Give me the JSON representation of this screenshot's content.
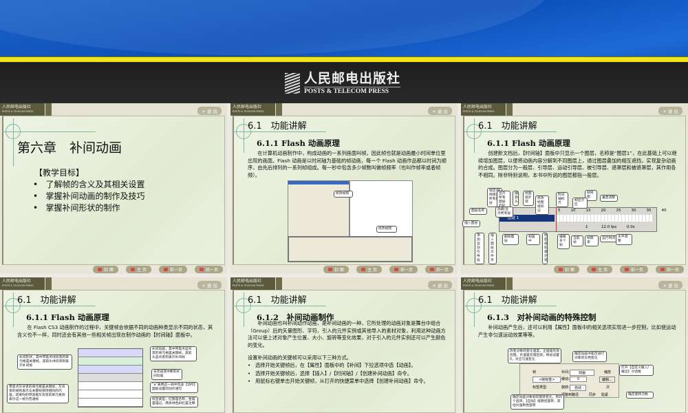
{
  "banner": {
    "logo_cn": "人民邮电出版社",
    "logo_en": "POSTS & TELECOM PRESS"
  },
  "chrome": {
    "plogo_cn": "人民邮电出版社",
    "plogo_en": "POSTS & TELECOM PRESS",
    "exit": "× 退 出",
    "nav": [
      "封 面",
      "主 页",
      "前一页",
      "后一页"
    ]
  },
  "slides": [
    {
      "title": "第六章　补间动画",
      "objectives_heading": "【教学目标】",
      "items": [
        "了解帧的含义及其相关设置",
        "掌握补间动画的制作及技巧",
        "掌握补间形状的制作"
      ]
    },
    {
      "section": "6.1　功能讲解",
      "sub": "6.1.1 Flash 动画原理",
      "para": "在计算机动画制作中，构成动画的一系列画面叫帧，因此帧也就是动画最小时间单位里出现的画面。Flash 动画是以时间轴为基础的帧动画，每一个 Flash 动画作品都以时间为顺序，由先后排列的一系列帧组成。每一秒中包含多少帧数叫做帧频率（也叫作帧率或者帧频）。",
      "callouts": [
        "修改帧频",
        "修改帧频"
      ]
    },
    {
      "section": "6.1　功能讲解",
      "sub": "6.1.1 Flash 动画原理",
      "para": "创建新文档后，【时间轴】面板中只显示一个图层，名称是“图层1”，在此基础上可以继续增加图层，以便将动画内容分解到不同图层上，通过图层叠加的相互遮挡，实现复杂动画的合成。图层分为一般层、引导层、运动引导层、被引导层、遮罩层和被遮罩层，其作用各不相同。除非特别说明，本书中所说的图层都指一般层。",
      "timeline": {
        "layer": "图层 1",
        "ruler": [
          "5",
          "10",
          "15",
          "20",
          "25",
          "30",
          "35",
          "40"
        ],
        "frame": "1",
        "fps": "12.0 fps",
        "time": "0.0s"
      },
      "callouts": [
        "锁定/解除锁定所有图层",
        "显示所有图层的轮廓",
        "播放头",
        "绘图纸外观",
        "修改绘图纸标记",
        "时间轴标尺",
        "帧视图",
        "垂直调整",
        "帧显示区",
        "图层名称",
        "隐藏/显示所有层",
        "插入图层",
        "添加运动引导层",
        "插入图层文件夹",
        "删除图层",
        "帧居中",
        "绘图纸轮廓外观",
        "编辑多个帧",
        "当前帧",
        "帧频率",
        "运行时间",
        "水平调整"
      ]
    },
    {
      "section": "6.1　功能讲解",
      "sub": "6.1.1 Flash 动画原理",
      "para": "在 Flash CS3 动画制作的过程中，关键帧会依据不同的动画种类显示不同的状态，其含义也不一样，同时还会有其他一些相关帧出现在制作动画的【时间轴】面板中。",
      "callouts": [
        "补间动画，其中带黑点蓝背景的单元格是关键帧，黑箭头蓝背景则表示补间帧",
        "补间形状，其中带黑点绿背景的单元格是关键帧，黑箭头绿背景则表示补间帧",
        "未完成或中断的补间动画",
        "带黑点灰背景的单元格是关键帧，灰背景的帧则表示与关键帧保持相同的内容，结束时的带黑框灰背景的单元格则表示这一帧为普通帧",
        "“a”表明这一帧中包含【动作】面板设置的动作语句",
        "标签类型，红旗是名称，金锚是锚记，两条绿色斜杠是注释"
      ]
    },
    {
      "section": "6.1　功能讲解",
      "sub": "6.1.2　补间动画制作",
      "para": "补间动画也叫补间动作动画，是补间动画的一种，它所处理的动画对象是舞台中组合（Group）后的矢量图形、字符、引入的元件实例或其他导入的素材对象，利用这种动画方法可以使上述对象产生位置、大小、旋转等变化效果，对于引入的元件实例还可以产生颜色的变化。",
      "lead": "设置补间动画的关键帧可以采用以下三种方式。",
      "items": [
        "选择开始关键帧后，在【属性】面板中的【补间】下拉选项中选【动画】。",
        "选择开始关键帧后，选择【插入】/【时间轴】/【创建补间动画】命令。",
        "用鼠标右键单击开始关键帧，从打开的快捷菜单中选择【创建补间动画】命令。"
      ]
    },
    {
      "section": "6.1　功能讲解",
      "sub": "6.1.3　对补间动画的特殊控制",
      "para": "补间动画产生后，还可以利用【属性】面板中的相关选项实现进一步控制，比如使运动产生非匀速运动效果等等。",
      "panel": {
        "frame": "帧",
        "label_ph": "<帧标签>",
        "tween": "补间:",
        "tween_val": "动画",
        "scale": "缩放",
        "ease": "缓动:",
        "ease_val": "0",
        "edit": "编辑...",
        "label_type": "标签类型:",
        "rotate": "旋转:",
        "rotate_val": "自动",
        "times": "次",
        "orient": "调整到路径",
        "sync": "同步",
        "snap": "贴紧"
      },
      "callouts": [
        "改变对象的变化速度，正值是先快后慢，负值是先慢后快，缺省设置0，对应匀速变化",
        "确定动画中能否进行对象的比例变化",
        "打开【自定义缓入/缓出】对话框",
        "确定旋转次数",
        "确定动画对象如何旋转变化，有四个选项，【自动】按键径旋转，其他为强制性旋转"
      ]
    }
  ]
}
